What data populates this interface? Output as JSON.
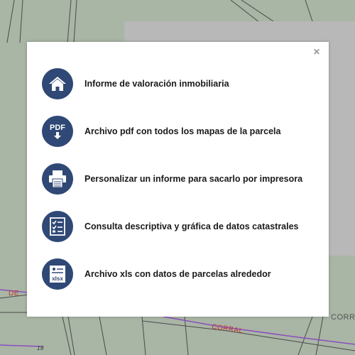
{
  "map": {
    "street_label_1": "DE",
    "street_label_2": "CORRAL",
    "street_label_3": "CORR",
    "parcel_number": "18"
  },
  "modal": {
    "close_symbol": "×",
    "options": [
      {
        "label": "Informe de valoración inmobiliaria",
        "icon": "home-icon"
      },
      {
        "label": "Archivo pdf con todos los mapas de la parcela",
        "icon": "pdf-download-icon",
        "icon_text": "PDF"
      },
      {
        "label": "Personalizar un informe para sacarlo por impresora",
        "icon": "printer-icon"
      },
      {
        "label": "Consulta descriptiva y gráfica de datos catastrales",
        "icon": "checklist-icon"
      },
      {
        "label": "Archivo xls con datos de parcelas alrededor",
        "icon": "xlsx-file-icon",
        "icon_text": "xlsx"
      }
    ],
    "accent_color": "#2f4875"
  }
}
